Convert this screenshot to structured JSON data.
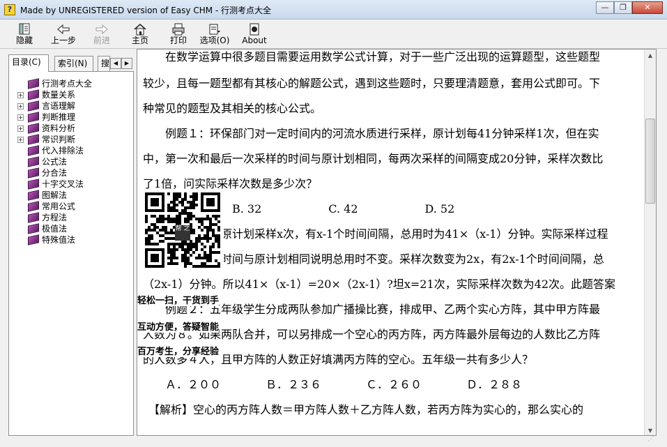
{
  "window": {
    "title": "Made by UNREGISTERED version of Easy CHM - 行测考点大全",
    "app_icon_glyph": "?",
    "min_glyph": "—",
    "max_glyph": "❐",
    "close_glyph": "✕"
  },
  "toolbar": {
    "hide": "隐藏",
    "back": "上一步",
    "forward": "前进",
    "home": "主页",
    "print": "打印",
    "options": "选项(O)",
    "about": "About"
  },
  "tabs": {
    "contents": "目录(C)",
    "index": "索引(N)",
    "search": "搜"
  },
  "tree": [
    {
      "label": "行测考点大全",
      "expandable": false
    },
    {
      "label": "数量关系",
      "expandable": true
    },
    {
      "label": "言语理解",
      "expandable": true
    },
    {
      "label": "判断推理",
      "expandable": true
    },
    {
      "label": "资料分析",
      "expandable": true
    },
    {
      "label": "常识判断",
      "expandable": true
    },
    {
      "label": "代入排除法",
      "expandable": false
    },
    {
      "label": "公式法",
      "expandable": false
    },
    {
      "label": "分合法",
      "expandable": false
    },
    {
      "label": "十字交叉法",
      "expandable": false
    },
    {
      "label": "图解法",
      "expandable": false
    },
    {
      "label": "常用公式",
      "expandable": false
    },
    {
      "label": "方程法",
      "expandable": false
    },
    {
      "label": "极值法",
      "expandable": false
    },
    {
      "label": "特殊值法",
      "expandable": false
    }
  ],
  "content": {
    "lines": [
      "　　在数学运算中很多题目需要运用数学公式计算，对于一些广泛出现的运算题型，这些题型",
      "较少，且每一题型都有其核心的解题公式，遇到这些题时，只要理清题意，套用公式即可。下",
      "种常见的题型及其相关的核心公式。",
      "　　例题１：环保部门对一定时间内的河流水质进行采样，原计划每41分钟采样1次，但在实",
      "中，第一次和最后一次采样的时间与原计划相同，每两次采样的间隔变成20分钟，采样次数比",
      "了1倍，问实际采样次数是多少次？",
      "　　　　　　　　B. 32　　　　　　C. 42　　　　　　D. 52",
      "　　　　　　　原计划采样x次，有x-1个时间间隔，总用时为41×（x-1）分钟。实际采样过程",
      "　　　　　　　时间与原计划相同说明总用时不变。采样次数变为2x，有2x-1个时间间隔，总",
      "（2x-1）分钟。所以41×（x-1）=20×（2x-1）?坦x=21次，实际采样次数为42次。此题答案",
      "　　例题２：五年级学生分成两队参加广播操比赛，排成甲、乙两个实心方阵，其中甲方阵最",
      "人数为８。如果两队合并，可以另排成一个空心的丙方阵，丙方阵最外层每边的人数比乙方阵",
      "的人数多４人，且甲方阵的人数正好填满丙方阵的空心。五年级一共有多少人？",
      "　　Ａ．２００　　　　Ｂ．２３６　　　　Ｃ．２６０　　　　Ｄ．２８８",
      "　【解析】空心的丙方阵人数＝甲方阵人数＋乙方阵人数，若丙方阵为实心的，那么实心的"
    ],
    "qr_captions": [
      "轻松一扫，干货到手",
      "互动方便，答疑智能",
      "百万考生，分享经验"
    ],
    "qr_center_text": "帮 之"
  },
  "colors": {
    "accent_book": "#7a2a85",
    "titlebar": "#c9d9ee"
  }
}
